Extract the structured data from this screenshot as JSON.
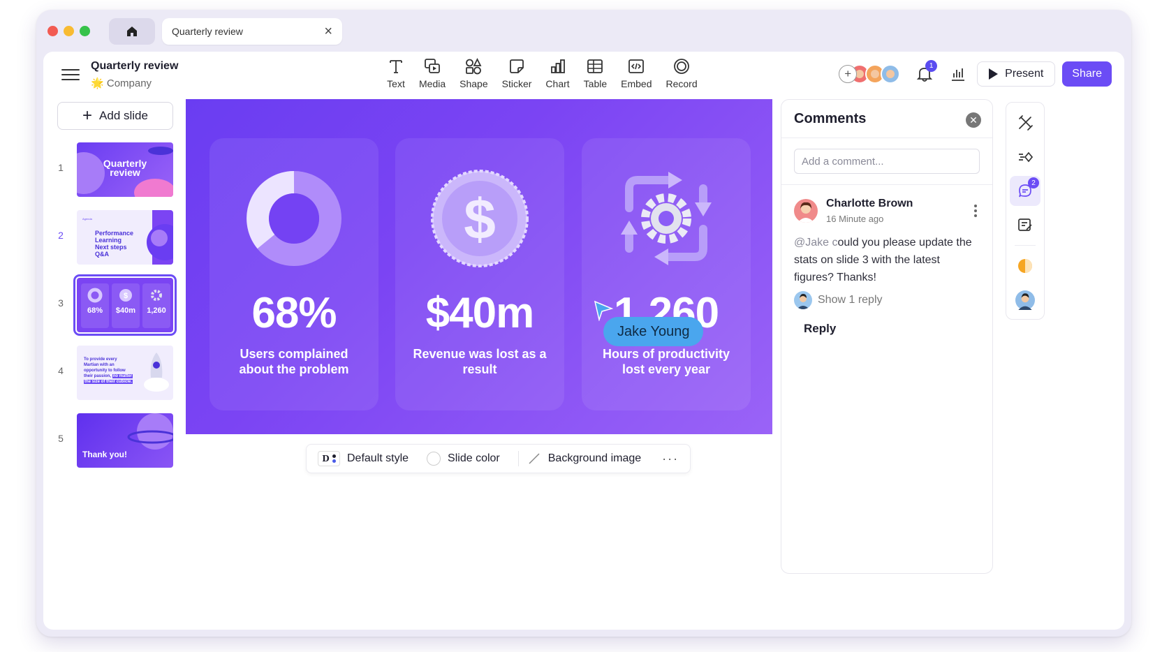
{
  "tabs": {
    "doc_tab_label": "Quarterly review"
  },
  "header": {
    "title": "Quarterly review",
    "workspace": "Company",
    "workspace_emoji": "🌟"
  },
  "toolbar": [
    {
      "label": "Text",
      "icon": "text-icon"
    },
    {
      "label": "Media",
      "icon": "media-icon"
    },
    {
      "label": "Shape",
      "icon": "shape-icon"
    },
    {
      "label": "Sticker",
      "icon": "sticker-icon"
    },
    {
      "label": "Chart",
      "icon": "chart-icon"
    },
    {
      "label": "Table",
      "icon": "table-icon"
    },
    {
      "label": "Embed",
      "icon": "embed-icon"
    },
    {
      "label": "Record",
      "icon": "record-icon"
    }
  ],
  "topbar": {
    "notification_count": "1",
    "present_label": "Present",
    "share_label": "Share"
  },
  "sidebar": {
    "add_slide_label": "Add slide",
    "slides": [
      {
        "number": "1",
        "lines": [
          "Quarterly",
          "review"
        ]
      },
      {
        "number": "2",
        "heading": "Agenda",
        "items": [
          "Performance",
          "Learning",
          "Next steps",
          "Q&A"
        ]
      },
      {
        "number": "3",
        "stats": [
          "68%",
          "$40m",
          "1,260"
        ]
      },
      {
        "number": "4",
        "lines": [
          "To provide every",
          "Martian with an",
          "opportunity to follow",
          "their passion,"
        ],
        "highlight": [
          "no matter",
          "the size of their cubicle."
        ]
      },
      {
        "number": "5",
        "lines": [
          "Thank you!"
        ]
      }
    ],
    "active_slide": 3
  },
  "slide": {
    "cards": [
      {
        "stat": "68%",
        "desc": "Users complained about the problem",
        "art": "donut-icon"
      },
      {
        "stat": "$40m",
        "desc": "Revenue was lost as a result",
        "art": "dollar-coin-icon"
      },
      {
        "stat": "1,260",
        "desc": "Hours of productivity lost every year",
        "art": "gear-cycle-icon"
      }
    ],
    "cursor_user": "Jake Young"
  },
  "style_bar": {
    "default_style": "Default style",
    "slide_color": "Slide color",
    "background_image": "Background image",
    "more": "···"
  },
  "comments": {
    "title": "Comments",
    "input_placeholder": "Add a comment...",
    "items": [
      {
        "author": "Charlotte Brown",
        "time": "16 Minute ago",
        "mention": "@Jake c",
        "text": "ould you please update the stats on slide 3 with the latest figures? Thanks!",
        "show_replies": "Show 1 reply",
        "reply_label": "Reply"
      }
    ]
  },
  "rail": {
    "comment_badge": "2"
  },
  "colors": {
    "accent": "#6b4cf5",
    "slide_bg": "#7b44f3",
    "cursor_tag": "#4aa6ee"
  }
}
